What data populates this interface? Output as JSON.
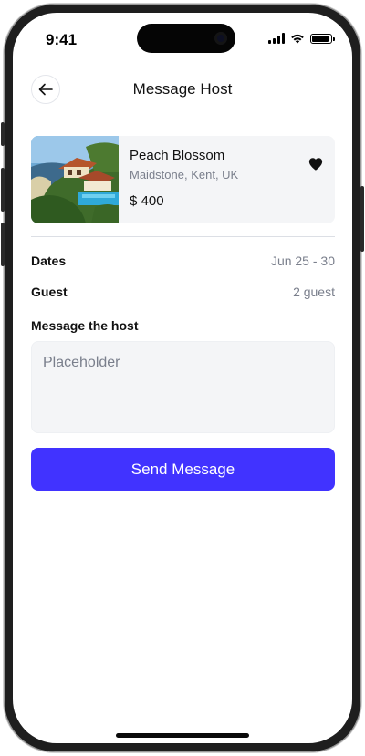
{
  "status_bar": {
    "time": "9:41",
    "icons": [
      "cellular-signal-icon",
      "wifi-icon",
      "battery-icon"
    ]
  },
  "header": {
    "back_icon": "arrow-left-icon",
    "title": "Message Host"
  },
  "listing": {
    "name": "Peach Blossom",
    "location": "Maidstone, Kent, UK",
    "price": "$ 400",
    "favorite_icon": "heart-icon",
    "favorited": true
  },
  "details": {
    "dates_label": "Dates",
    "dates_value": "Jun 25 - 30",
    "guest_label": "Guest",
    "guest_value": "2 guest"
  },
  "message": {
    "label": "Message the host",
    "placeholder": "Placeholder",
    "value": ""
  },
  "actions": {
    "send_label": "Send Message"
  },
  "colors": {
    "accent": "#4133ff",
    "card_bg": "#f4f5f7",
    "muted_text": "#7a7f8c",
    "primary_text": "#111111"
  }
}
